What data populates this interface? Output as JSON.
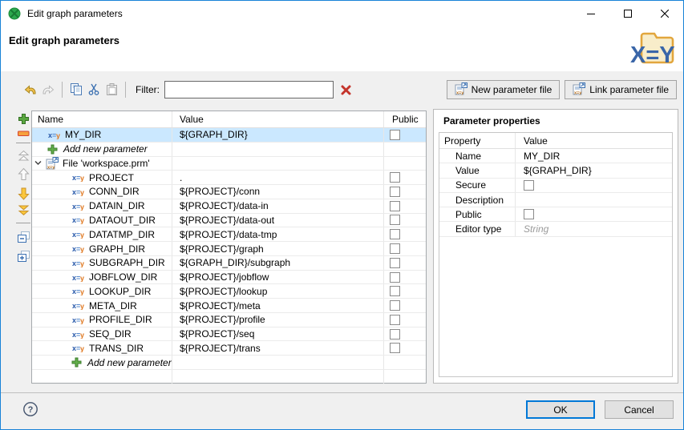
{
  "titlebar": {
    "title": "Edit graph parameters"
  },
  "banner": {
    "title": "Edit graph parameters"
  },
  "toolbar": {
    "filter_label": "Filter:",
    "filter_value": "",
    "new_file_button": "New parameter file",
    "link_file_button": "Link parameter file"
  },
  "param_table": {
    "columns": [
      "Name",
      "Value",
      "Public"
    ],
    "rows": [
      {
        "kind": "param",
        "level": 1,
        "name": "MY_DIR",
        "value": "${GRAPH_DIR}",
        "public": false,
        "selected": true
      },
      {
        "kind": "add",
        "level": 1,
        "label": "Add new parameter"
      },
      {
        "kind": "file",
        "label": "File 'workspace.prm'",
        "expanded": true
      },
      {
        "kind": "param",
        "level": 2,
        "name": "PROJECT",
        "value": ".",
        "public": false
      },
      {
        "kind": "param",
        "level": 2,
        "name": "CONN_DIR",
        "value": "${PROJECT}/conn",
        "public": false
      },
      {
        "kind": "param",
        "level": 2,
        "name": "DATAIN_DIR",
        "value": "${PROJECT}/data-in",
        "public": false
      },
      {
        "kind": "param",
        "level": 2,
        "name": "DATAOUT_DIR",
        "value": "${PROJECT}/data-out",
        "public": false
      },
      {
        "kind": "param",
        "level": 2,
        "name": "DATATMP_DIR",
        "value": "${PROJECT}/data-tmp",
        "public": false
      },
      {
        "kind": "param",
        "level": 2,
        "name": "GRAPH_DIR",
        "value": "${PROJECT}/graph",
        "public": false
      },
      {
        "kind": "param",
        "level": 2,
        "name": "SUBGRAPH_DIR",
        "value": "${GRAPH_DIR}/subgraph",
        "public": false
      },
      {
        "kind": "param",
        "level": 2,
        "name": "JOBFLOW_DIR",
        "value": "${PROJECT}/jobflow",
        "public": false
      },
      {
        "kind": "param",
        "level": 2,
        "name": "LOOKUP_DIR",
        "value": "${PROJECT}/lookup",
        "public": false
      },
      {
        "kind": "param",
        "level": 2,
        "name": "META_DIR",
        "value": "${PROJECT}/meta",
        "public": false
      },
      {
        "kind": "param",
        "level": 2,
        "name": "PROFILE_DIR",
        "value": "${PROJECT}/profile",
        "public": false
      },
      {
        "kind": "param",
        "level": 2,
        "name": "SEQ_DIR",
        "value": "${PROJECT}/seq",
        "public": false
      },
      {
        "kind": "param",
        "level": 2,
        "name": "TRANS_DIR",
        "value": "${PROJECT}/trans",
        "public": false
      },
      {
        "kind": "add",
        "level": 2,
        "label": "Add new parameter"
      },
      {
        "kind": "empty"
      }
    ]
  },
  "properties": {
    "title": "Parameter properties",
    "columns": [
      "Property",
      "Value"
    ],
    "rows": [
      {
        "property": "Name",
        "value": "MY_DIR"
      },
      {
        "property": "Value",
        "value": "${GRAPH_DIR}"
      },
      {
        "property": "Secure",
        "checkbox": true,
        "checked": false
      },
      {
        "property": "Description",
        "value": ""
      },
      {
        "property": "Public",
        "checkbox": true,
        "checked": false
      },
      {
        "property": "Editor type",
        "value": "String",
        "placeholder": true
      }
    ]
  },
  "footer": {
    "ok": "OK",
    "cancel": "Cancel"
  }
}
